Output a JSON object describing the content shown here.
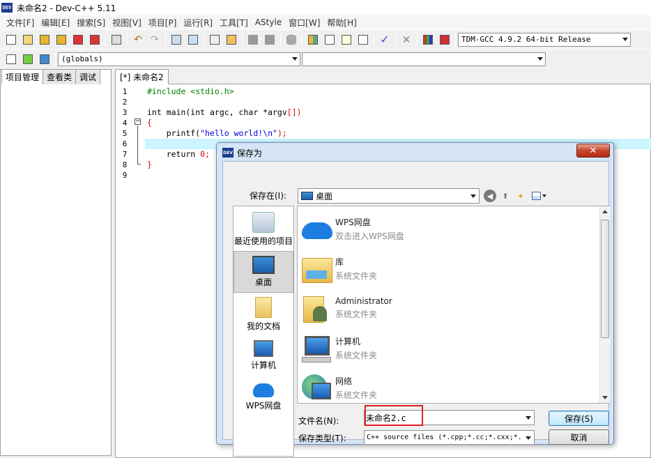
{
  "window": {
    "title": "未命名2 - Dev-C++ 5.11",
    "logo_text": "DEV"
  },
  "menu": [
    "文件[F]",
    "编辑[E]",
    "搜索[S]",
    "视图[V]",
    "项目[P]",
    "运行[R]",
    "工具[T]",
    "AStyle",
    "窗口[W]",
    "帮助[H]"
  ],
  "toolbar": {
    "compiler_select": "TDM-GCC 4.9.2 64-bit Release",
    "scope_select": "(globals)",
    "member_select": ""
  },
  "left_panel": {
    "tabs": [
      "项目管理",
      "查看类",
      "调试"
    ]
  },
  "editor": {
    "tab_label": "[*] 未命名2",
    "line_numbers": [
      "1",
      "2",
      "3",
      "4",
      "5",
      "6",
      "7",
      "8",
      "9"
    ],
    "lines": {
      "l1": "#include <stdio.h>",
      "l3a": "int main(int argc, char *argv",
      "l3b": "[]",
      "l3c": ")",
      "l4": "{",
      "l5a": "    printf(",
      "l5b": "\"hello world!\\n\"",
      "l5c": ");",
      "l7a": "    return ",
      "l7b": "0",
      "l7c": ";",
      "l8": "}"
    }
  },
  "dialog": {
    "title": "保存为",
    "close_glyph": "✕",
    "save_in_label": "保存在(I):",
    "save_in_value": "桌面",
    "places": [
      {
        "label": "最近使用的项目",
        "icon": "recent-icon"
      },
      {
        "label": "桌面",
        "icon": "desktop-icon"
      },
      {
        "label": "我的文档",
        "icon": "documents-icon"
      },
      {
        "label": "计算机",
        "icon": "computer-icon"
      },
      {
        "label": "WPS网盘",
        "icon": "wps-cloud-icon"
      }
    ],
    "files": [
      {
        "name": "WPS网盘",
        "sub": "双击进入WPS网盘",
        "icon": "wps-cloud-icon"
      },
      {
        "name": "库",
        "sub": "系统文件夹",
        "icon": "library-folder-icon"
      },
      {
        "name": "Administrator",
        "sub": "系统文件夹",
        "icon": "user-folder-icon"
      },
      {
        "name": "计算机",
        "sub": "系统文件夹",
        "icon": "computer-icon"
      },
      {
        "name": "网络",
        "sub": "系统文件夹",
        "icon": "network-icon"
      }
    ],
    "filename_label": "文件名(N):",
    "filename_value": "未命名2.c",
    "filetype_label": "保存类型(T):",
    "filetype_value": "C++ source files (*.cpp;*.cc;*.cxx;*.",
    "save_button": "保存(S)",
    "cancel_button": "取消"
  },
  "colors": {
    "accent_red": "#e02020",
    "current_line": "#ccf5ff",
    "string": "#0000cc",
    "preprocessor": "#008000"
  }
}
